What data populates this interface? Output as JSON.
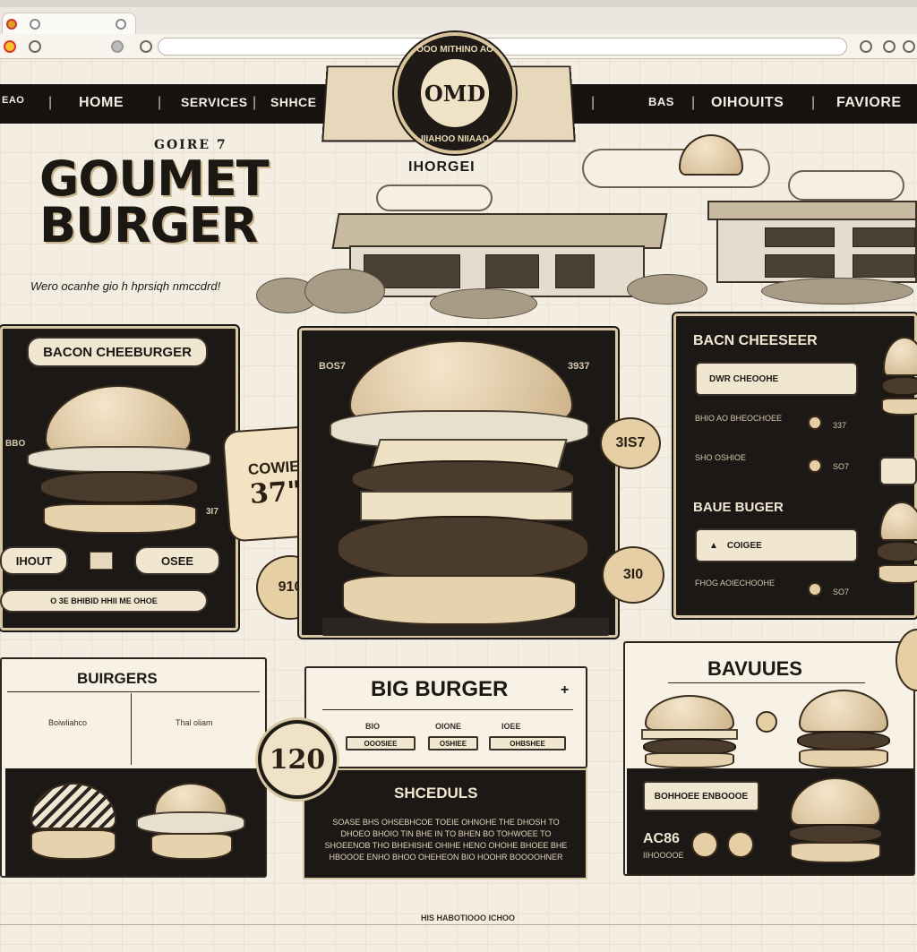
{
  "browser": {
    "url": ""
  },
  "nav": {
    "items": [
      "HOME",
      "SERVICES",
      "SHHCE",
      "BAS",
      "OIHOUITS",
      "FAVIORE"
    ],
    "left_stub": "EAO"
  },
  "logo": {
    "center": "OMD",
    "ring_top": "OOO MITHINO AO",
    "ring_bottom": "IIIAHOO NIIAAO"
  },
  "hero": {
    "subtitle": "GOIRE 7",
    "title_line1": "GOUMET",
    "title_line2": "BURGER",
    "tagline": "Wero ocanhe gio h hprsiqh nmccdrd!",
    "scene_label": "IHORGEI"
  },
  "left_panel": {
    "title": "BACON CHEEBURGER",
    "price_left": "BBO",
    "price_right": "3I7",
    "btn_left": "IHOUT",
    "btn_right": "OSEE",
    "bar_text": "O 3E BHIBID HHII ME OHOE",
    "tag": {
      "top": "COWIE",
      "bottom": "37\""
    },
    "coin": "910"
  },
  "center_panel": {
    "left_price": "BOS7",
    "right_price": "3937",
    "coin_top": "3IS7",
    "coin_bottom": "3I0"
  },
  "right_panel": {
    "title1": "BACN CHEESEER",
    "field1": "DWR CHEOOHE",
    "row1_text": "BHIO AO BHEOCHOEE",
    "row1_price": "337",
    "row2_text": "SHO OSHIOE",
    "row2_price": "SO7",
    "title2": "BAUE BUGER",
    "field2": "COIGEE",
    "row3_text": "FHOG AOIECHOOHE",
    "row3_price": "SO7"
  },
  "burgers_panel": {
    "title": "BUIRGERS",
    "item1": "Boiwliahco",
    "item2": "Thal oliam"
  },
  "big_panel": {
    "title": "BIG BURGER",
    "tabs": [
      "BIO",
      "OIONE",
      "IOEE"
    ],
    "tab_btns": [
      "OOOSIEE",
      "OSHIEE",
      "OHBSHEE"
    ],
    "coin": "120",
    "schedule": "SHCEDULS",
    "body": "SOASE BHS OHSEBHCOE TOEIE OHNOHE THE DHOSH TO DHOEO BHOIO TIN BHE IN TO BHEN BO TOHWOEE TO SHOEENOB THO BHEHISHE OHIHE HENO OHOHE BHOEE BHE HBOOOE ENHO BHOO OHEHEON BIO HOOHR BOOOOHNER"
  },
  "values_panel": {
    "title": "BAVUUES",
    "btn": "BOHHOEE ENBOOOE",
    "price": "AC86",
    "price_sub": "IIHOOOOE"
  },
  "footer": {
    "text": "HIS HABOTIOOO ICHOO"
  }
}
